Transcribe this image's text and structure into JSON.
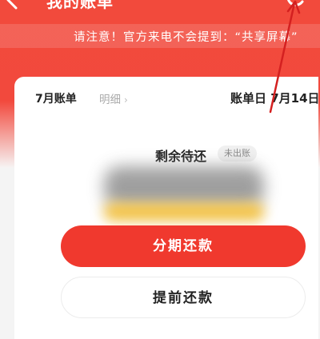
{
  "header": {
    "title": "我的账单"
  },
  "notice": {
    "text": "请注意！官方来电不会提到：“共享屏幕”"
  },
  "bill": {
    "tab_bill": "7月账单",
    "tab_detail": "明细",
    "bill_day": "账单日 7月14日"
  },
  "summary": {
    "remaining_label": "剩余待还",
    "status_badge": "未出账"
  },
  "actions": {
    "installment_label": "分期还款",
    "prepay_label": "提前还款"
  },
  "colors": {
    "brand_red": "#f0392e",
    "annotation_red": "#d42020"
  }
}
